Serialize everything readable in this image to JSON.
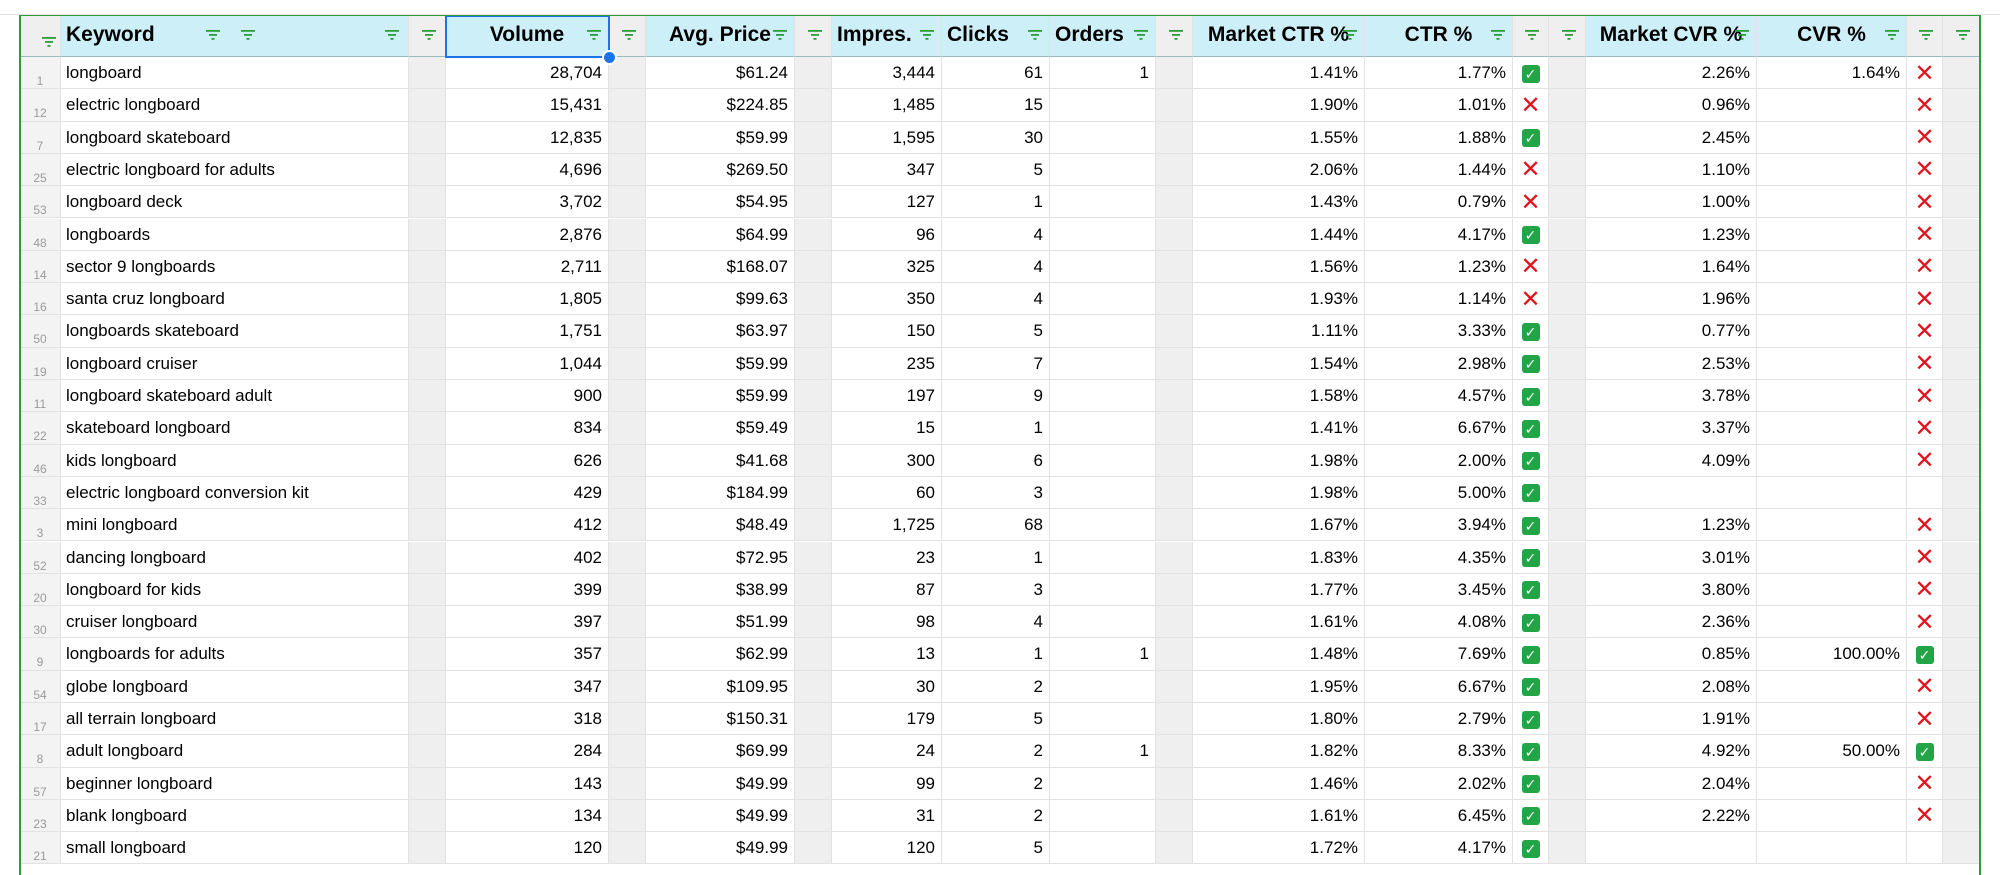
{
  "sheet": {
    "columns": [
      {
        "key": "keyword",
        "label": "Keyword",
        "align": "left",
        "filters": 3
      },
      {
        "key": "volume",
        "label": "Volume",
        "align": "center",
        "filters": 1
      },
      {
        "key": "price",
        "label": "Avg. Price",
        "align": "center",
        "filters": 1
      },
      {
        "key": "impressions",
        "label": "Impres.",
        "align": "left",
        "filters": 1
      },
      {
        "key": "clicks",
        "label": "Clicks",
        "align": "left",
        "filters": 1
      },
      {
        "key": "orders",
        "label": "Orders",
        "align": "left",
        "filters": 1
      },
      {
        "key": "market_ctr",
        "label": "Market CTR %",
        "align": "center",
        "filters": 1
      },
      {
        "key": "ctr",
        "label": "CTR %",
        "align": "center",
        "filters": 1
      },
      {
        "key": "market_cvr",
        "label": "Market CVR %",
        "align": "center",
        "filters": 1
      },
      {
        "key": "cvr",
        "label": "CVR %",
        "align": "center",
        "filters": 1
      }
    ],
    "rows": [
      {
        "rn": "1",
        "keyword": "longboard",
        "volume": "28,704",
        "price": "$61.24",
        "impressions": "3,444",
        "clicks": "61",
        "orders": "1",
        "market_ctr": "1.41%",
        "ctr": "1.77%",
        "ctr_ok": true,
        "market_cvr": "2.26%",
        "cvr": "1.64%",
        "cvr_ok": false
      },
      {
        "rn": "12",
        "keyword": "electric longboard",
        "volume": "15,431",
        "price": "$224.85",
        "impressions": "1,485",
        "clicks": "15",
        "orders": "",
        "market_ctr": "1.90%",
        "ctr": "1.01%",
        "ctr_ok": false,
        "market_cvr": "0.96%",
        "cvr": "",
        "cvr_ok": false
      },
      {
        "rn": "7",
        "keyword": "longboard skateboard",
        "volume": "12,835",
        "price": "$59.99",
        "impressions": "1,595",
        "clicks": "30",
        "orders": "",
        "market_ctr": "1.55%",
        "ctr": "1.88%",
        "ctr_ok": true,
        "market_cvr": "2.45%",
        "cvr": "",
        "cvr_ok": false
      },
      {
        "rn": "25",
        "keyword": "electric longboard for adults",
        "volume": "4,696",
        "price": "$269.50",
        "impressions": "347",
        "clicks": "5",
        "orders": "",
        "market_ctr": "2.06%",
        "ctr": "1.44%",
        "ctr_ok": false,
        "market_cvr": "1.10%",
        "cvr": "",
        "cvr_ok": false
      },
      {
        "rn": "53",
        "keyword": "longboard deck",
        "volume": "3,702",
        "price": "$54.95",
        "impressions": "127",
        "clicks": "1",
        "orders": "",
        "market_ctr": "1.43%",
        "ctr": "0.79%",
        "ctr_ok": false,
        "market_cvr": "1.00%",
        "cvr": "",
        "cvr_ok": false
      },
      {
        "rn": "48",
        "keyword": "longboards",
        "volume": "2,876",
        "price": "$64.99",
        "impressions": "96",
        "clicks": "4",
        "orders": "",
        "market_ctr": "1.44%",
        "ctr": "4.17%",
        "ctr_ok": true,
        "market_cvr": "1.23%",
        "cvr": "",
        "cvr_ok": false
      },
      {
        "rn": "14",
        "keyword": "sector 9 longboards",
        "volume": "2,711",
        "price": "$168.07",
        "impressions": "325",
        "clicks": "4",
        "orders": "",
        "market_ctr": "1.56%",
        "ctr": "1.23%",
        "ctr_ok": false,
        "market_cvr": "1.64%",
        "cvr": "",
        "cvr_ok": false
      },
      {
        "rn": "16",
        "keyword": "santa cruz longboard",
        "volume": "1,805",
        "price": "$99.63",
        "impressions": "350",
        "clicks": "4",
        "orders": "",
        "market_ctr": "1.93%",
        "ctr": "1.14%",
        "ctr_ok": false,
        "market_cvr": "1.96%",
        "cvr": "",
        "cvr_ok": false
      },
      {
        "rn": "50",
        "keyword": "longboards skateboard",
        "volume": "1,751",
        "price": "$63.97",
        "impressions": "150",
        "clicks": "5",
        "orders": "",
        "market_ctr": "1.11%",
        "ctr": "3.33%",
        "ctr_ok": true,
        "market_cvr": "0.77%",
        "cvr": "",
        "cvr_ok": false
      },
      {
        "rn": "19",
        "keyword": "longboard cruiser",
        "volume": "1,044",
        "price": "$59.99",
        "impressions": "235",
        "clicks": "7",
        "orders": "",
        "market_ctr": "1.54%",
        "ctr": "2.98%",
        "ctr_ok": true,
        "market_cvr": "2.53%",
        "cvr": "",
        "cvr_ok": false
      },
      {
        "rn": "11",
        "keyword": "longboard skateboard adult",
        "volume": "900",
        "price": "$59.99",
        "impressions": "197",
        "clicks": "9",
        "orders": "",
        "market_ctr": "1.58%",
        "ctr": "4.57%",
        "ctr_ok": true,
        "market_cvr": "3.78%",
        "cvr": "",
        "cvr_ok": false
      },
      {
        "rn": "22",
        "keyword": "skateboard longboard",
        "volume": "834",
        "price": "$59.49",
        "impressions": "15",
        "clicks": "1",
        "orders": "",
        "market_ctr": "1.41%",
        "ctr": "6.67%",
        "ctr_ok": true,
        "market_cvr": "3.37%",
        "cvr": "",
        "cvr_ok": false
      },
      {
        "rn": "46",
        "keyword": "kids longboard",
        "volume": "626",
        "price": "$41.68",
        "impressions": "300",
        "clicks": "6",
        "orders": "",
        "market_ctr": "1.98%",
        "ctr": "2.00%",
        "ctr_ok": true,
        "market_cvr": "4.09%",
        "cvr": "",
        "cvr_ok": false
      },
      {
        "rn": "33",
        "keyword": "electric longboard conversion kit",
        "volume": "429",
        "price": "$184.99",
        "impressions": "60",
        "clicks": "3",
        "orders": "",
        "market_ctr": "1.98%",
        "ctr": "5.00%",
        "ctr_ok": true,
        "market_cvr": "",
        "cvr": "",
        "cvr_ok": null
      },
      {
        "rn": "3",
        "keyword": "mini longboard",
        "volume": "412",
        "price": "$48.49",
        "impressions": "1,725",
        "clicks": "68",
        "orders": "",
        "market_ctr": "1.67%",
        "ctr": "3.94%",
        "ctr_ok": true,
        "market_cvr": "1.23%",
        "cvr": "",
        "cvr_ok": false
      },
      {
        "rn": "52",
        "keyword": "dancing longboard",
        "volume": "402",
        "price": "$72.95",
        "impressions": "23",
        "clicks": "1",
        "orders": "",
        "market_ctr": "1.83%",
        "ctr": "4.35%",
        "ctr_ok": true,
        "market_cvr": "3.01%",
        "cvr": "",
        "cvr_ok": false
      },
      {
        "rn": "20",
        "keyword": "longboard for kids",
        "volume": "399",
        "price": "$38.99",
        "impressions": "87",
        "clicks": "3",
        "orders": "",
        "market_ctr": "1.77%",
        "ctr": "3.45%",
        "ctr_ok": true,
        "market_cvr": "3.80%",
        "cvr": "",
        "cvr_ok": false
      },
      {
        "rn": "30",
        "keyword": "cruiser longboard",
        "volume": "397",
        "price": "$51.99",
        "impressions": "98",
        "clicks": "4",
        "orders": "",
        "market_ctr": "1.61%",
        "ctr": "4.08%",
        "ctr_ok": true,
        "market_cvr": "2.36%",
        "cvr": "",
        "cvr_ok": false
      },
      {
        "rn": "9",
        "keyword": "longboards for adults",
        "volume": "357",
        "price": "$62.99",
        "impressions": "13",
        "clicks": "1",
        "orders": "1",
        "market_ctr": "1.48%",
        "ctr": "7.69%",
        "ctr_ok": true,
        "market_cvr": "0.85%",
        "cvr": "100.00%",
        "cvr_ok": true
      },
      {
        "rn": "54",
        "keyword": "globe longboard",
        "volume": "347",
        "price": "$109.95",
        "impressions": "30",
        "clicks": "2",
        "orders": "",
        "market_ctr": "1.95%",
        "ctr": "6.67%",
        "ctr_ok": true,
        "market_cvr": "2.08%",
        "cvr": "",
        "cvr_ok": false
      },
      {
        "rn": "17",
        "keyword": "all terrain longboard",
        "volume": "318",
        "price": "$150.31",
        "impressions": "179",
        "clicks": "5",
        "orders": "",
        "market_ctr": "1.80%",
        "ctr": "2.79%",
        "ctr_ok": true,
        "market_cvr": "1.91%",
        "cvr": "",
        "cvr_ok": false
      },
      {
        "rn": "8",
        "keyword": "adult longboard",
        "volume": "284",
        "price": "$69.99",
        "impressions": "24",
        "clicks": "2",
        "orders": "1",
        "market_ctr": "1.82%",
        "ctr": "8.33%",
        "ctr_ok": true,
        "market_cvr": "4.92%",
        "cvr": "50.00%",
        "cvr_ok": true
      },
      {
        "rn": "57",
        "keyword": "beginner longboard",
        "volume": "143",
        "price": "$49.99",
        "impressions": "99",
        "clicks": "2",
        "orders": "",
        "market_ctr": "1.46%",
        "ctr": "2.02%",
        "ctr_ok": true,
        "market_cvr": "2.04%",
        "cvr": "",
        "cvr_ok": false
      },
      {
        "rn": "23",
        "keyword": "blank longboard",
        "volume": "134",
        "price": "$49.99",
        "impressions": "31",
        "clicks": "2",
        "orders": "",
        "market_ctr": "1.61%",
        "ctr": "6.45%",
        "ctr_ok": true,
        "market_cvr": "2.22%",
        "cvr": "",
        "cvr_ok": false
      },
      {
        "rn": "21",
        "keyword": "small longboard",
        "volume": "120",
        "price": "$49.99",
        "impressions": "120",
        "clicks": "5",
        "orders": "",
        "market_ctr": "1.72%",
        "ctr": "4.17%",
        "ctr_ok": true,
        "market_cvr": "",
        "cvr": "",
        "cvr_ok": null
      }
    ],
    "selected_column": "volume",
    "icons": {
      "filter": "filter-icon",
      "check": "check-mark-icon",
      "cross": "cross-mark-icon"
    },
    "colors": {
      "header_bg": "#cdeff8",
      "selection": "#1a73e8",
      "check": "#21a547",
      "cross": "#e0141c",
      "filter": "#2d9c3a"
    }
  }
}
